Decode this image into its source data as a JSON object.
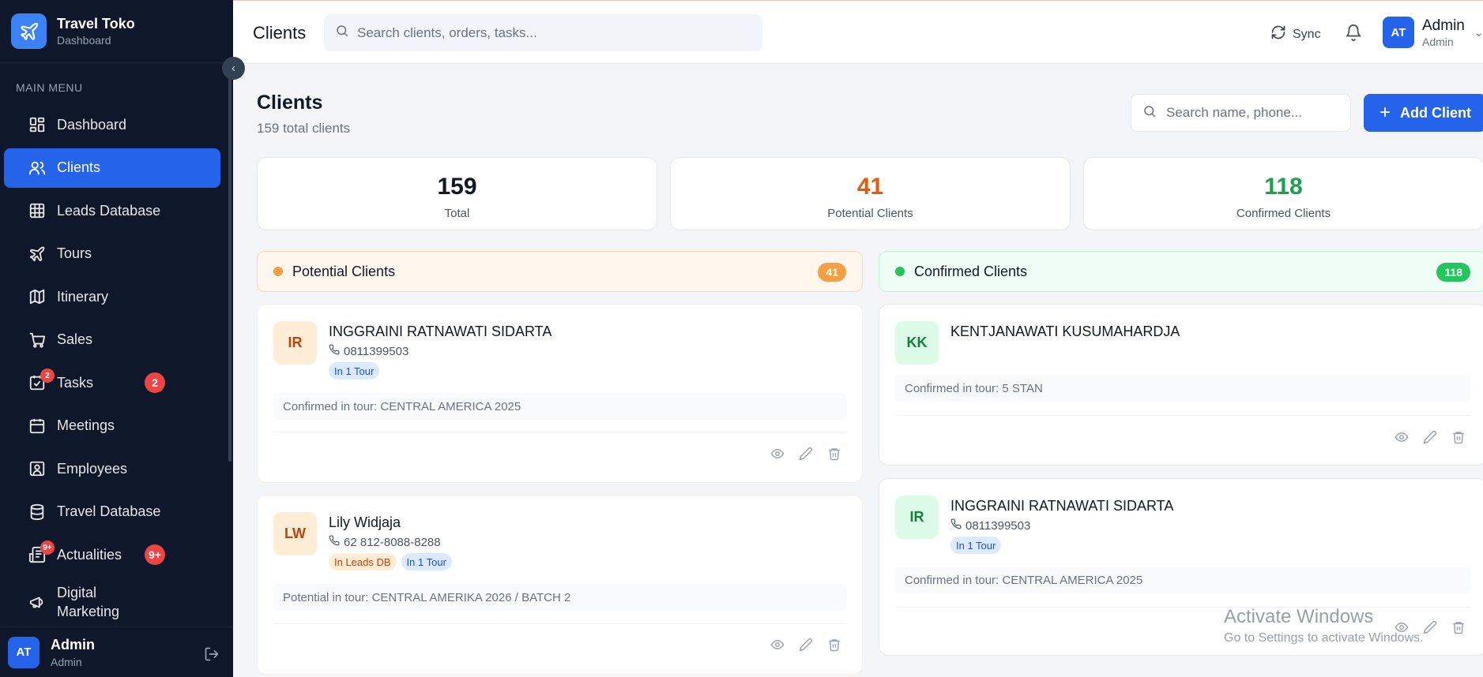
{
  "brand": {
    "title": "Travel Toko",
    "subtitle": "Dashboard"
  },
  "sidebar": {
    "menu_label": "MAIN MENU",
    "items": [
      {
        "label": "Dashboard",
        "icon": "dashboard-icon"
      },
      {
        "label": "Clients",
        "icon": "users-icon",
        "active": true
      },
      {
        "label": "Leads Database",
        "icon": "table-icon"
      },
      {
        "label": "Tours",
        "icon": "plane-icon"
      },
      {
        "label": "Itinerary",
        "icon": "map-icon"
      },
      {
        "label": "Sales",
        "icon": "cart-icon"
      },
      {
        "label": "Tasks",
        "icon": "tasks-icon",
        "badge": "2",
        "icon_badge": "2"
      },
      {
        "label": "Meetings",
        "icon": "calendar-icon"
      },
      {
        "label": "Employees",
        "icon": "employee-icon"
      },
      {
        "label": "Travel Database",
        "icon": "database-icon"
      },
      {
        "label": "Actualities",
        "icon": "news-icon",
        "badge": "9+",
        "icon_badge": "9+"
      },
      {
        "label": "Digital Marketing",
        "label_line1": "Digital",
        "label_line2": "Marketing",
        "icon": "megaphone-icon"
      }
    ],
    "footer": {
      "initials": "AT",
      "name": "Admin",
      "role": "Admin"
    }
  },
  "topbar": {
    "title": "Clients",
    "search_placeholder": "Search clients, orders, tasks...",
    "sync_label": "Sync",
    "user": {
      "initials": "AT",
      "name": "Admin",
      "role": "Admin"
    }
  },
  "page": {
    "title": "Clients",
    "subtitle": "159 total clients",
    "search_placeholder": "Search name, phone...",
    "add_label": "Add Client"
  },
  "stats": [
    {
      "value": "159",
      "label": "Total",
      "color": "#111827"
    },
    {
      "value": "41",
      "label": "Potential Clients",
      "color": "#ea580c"
    },
    {
      "value": "118",
      "label": "Confirmed Clients",
      "color": "#16a34a"
    }
  ],
  "columns": {
    "potential": {
      "title": "Potential Clients",
      "count": "41",
      "accent": "#f59e42",
      "bg": "#fff7ed"
    },
    "confirmed": {
      "title": "Confirmed Clients",
      "count": "118",
      "accent": "#22c55e",
      "bg": "#f0fdf4"
    }
  },
  "potential_cards": [
    {
      "initials": "IR",
      "name": "INGGRAINI RATNAWATI SIDARTA",
      "phone": "0811399503",
      "tags": [
        "In 1 Tour"
      ],
      "note": "Confirmed in tour: CENTRAL AMERICA 2025"
    },
    {
      "initials": "LW",
      "name": "Lily Widjaja",
      "phone": "62 812-8088-8288",
      "tags": [
        "In Leads DB",
        "In 1 Tour"
      ],
      "note": "Potential in tour: CENTRAL AMERIKA 2026 / BATCH 2"
    }
  ],
  "confirmed_cards": [
    {
      "initials": "KK",
      "name": "KENTJANAWATI KUSUMAHARDJA",
      "note": "Confirmed in tour: 5 STAN"
    },
    {
      "initials": "IR",
      "name": "INGGRAINI RATNAWATI SIDARTA",
      "phone": "0811399503",
      "tags": [
        "In 1 Tour"
      ],
      "note": "Confirmed in tour: CENTRAL AMERICA 2025"
    }
  ],
  "watermark": {
    "title": "Activate Windows",
    "subtitle": "Go to Settings to activate Windows."
  }
}
